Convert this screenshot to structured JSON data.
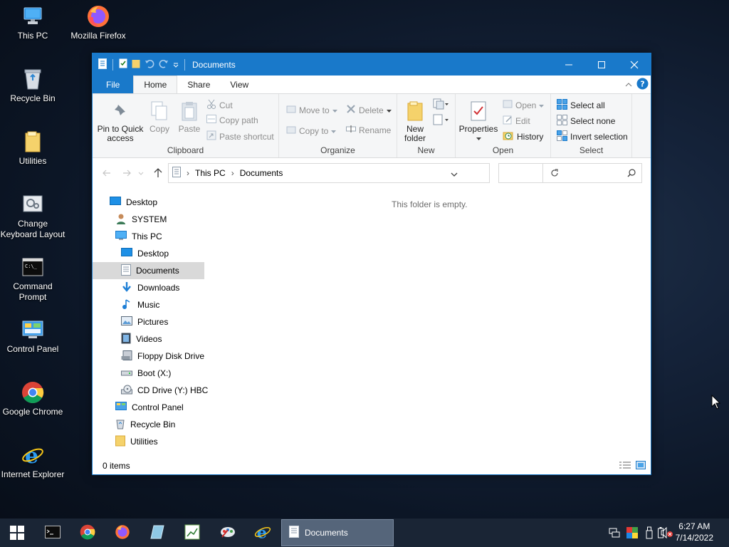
{
  "desktop": {
    "icons": [
      {
        "label": "This PC"
      },
      {
        "label": "Mozilla Firefox"
      },
      {
        "label": "Recycle Bin"
      },
      {
        "label": "Utilities"
      },
      {
        "label_line1": "Change",
        "label_line2": "Keyboard Layout"
      },
      {
        "label_line1": "Command",
        "label_line2": "Prompt"
      },
      {
        "label": "Control Panel"
      },
      {
        "label": "Google Chrome"
      },
      {
        "label": "Internet Explorer"
      }
    ]
  },
  "window": {
    "title": "Documents",
    "tabs": {
      "file": "File",
      "home": "Home",
      "share": "Share",
      "view": "View"
    },
    "ribbon": {
      "clipboard": {
        "pin_line1": "Pin to Quick",
        "pin_line2": "access",
        "copy": "Copy",
        "paste": "Paste",
        "cut": "Cut",
        "copy_path": "Copy path",
        "paste_shortcut": "Paste shortcut",
        "label": "Clipboard"
      },
      "organize": {
        "move_to": "Move to",
        "copy_to": "Copy to",
        "delete": "Delete",
        "rename": "Rename",
        "label": "Organize"
      },
      "new": {
        "new_line1": "New",
        "new_line2": "folder",
        "label": "New"
      },
      "open": {
        "properties": "Properties",
        "open": "Open",
        "edit": "Edit",
        "history": "History",
        "label": "Open"
      },
      "select": {
        "select_all": "Select all",
        "select_none": "Select none",
        "invert": "Invert selection",
        "label": "Select"
      }
    },
    "address": {
      "crumbs": [
        "This PC",
        "Documents"
      ]
    },
    "search": {
      "placeholder": ""
    },
    "nav": [
      {
        "label": "Desktop"
      },
      {
        "label": "SYSTEM"
      },
      {
        "label": "This PC"
      },
      {
        "label": "Desktop"
      },
      {
        "label": "Documents"
      },
      {
        "label": "Downloads"
      },
      {
        "label": "Music"
      },
      {
        "label": "Pictures"
      },
      {
        "label": "Videos"
      },
      {
        "label": "Floppy Disk Drive"
      },
      {
        "label": "Boot (X:)"
      },
      {
        "label": "CD Drive (Y:) HBC"
      },
      {
        "label": "Control Panel"
      },
      {
        "label": "Recycle Bin"
      },
      {
        "label": "Utilities"
      }
    ],
    "empty_text": "This folder is empty.",
    "status": "0 items"
  },
  "taskbar": {
    "active_task": "Documents",
    "time": "6:27 AM",
    "date": "7/14/2022"
  },
  "colors": {
    "accent": "#1979ca",
    "taskbar": "#1a2535",
    "selection": "#d9d9d9"
  }
}
